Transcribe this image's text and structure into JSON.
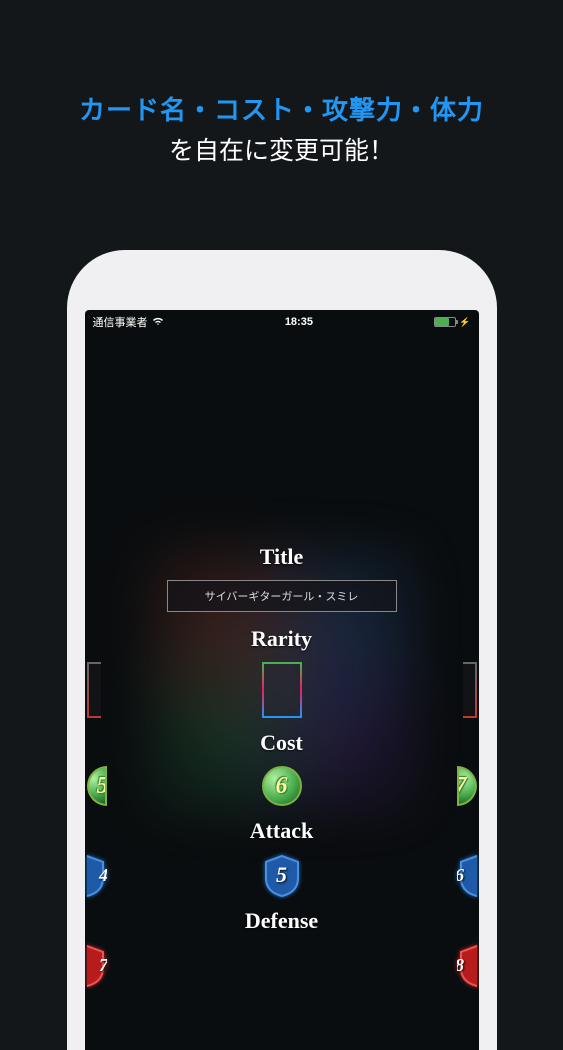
{
  "promo": {
    "line1": "カード名・コスト・攻撃力・体力",
    "line2": "を自在に変更可能！"
  },
  "status_bar": {
    "carrier": "通信事業者",
    "time": "18:35"
  },
  "editor": {
    "title_label": "Title",
    "title_value": "サイバーギターガール・スミレ",
    "rarity_label": "Rarity",
    "cost_label": "Cost",
    "cost_values": {
      "left": "5",
      "center": "6",
      "right": "7"
    },
    "attack_label": "Attack",
    "attack_values": {
      "left": "4",
      "center": "5",
      "right": "6"
    },
    "defense_label": "Defense",
    "defense_values": {
      "left": "7",
      "right": "8"
    }
  }
}
